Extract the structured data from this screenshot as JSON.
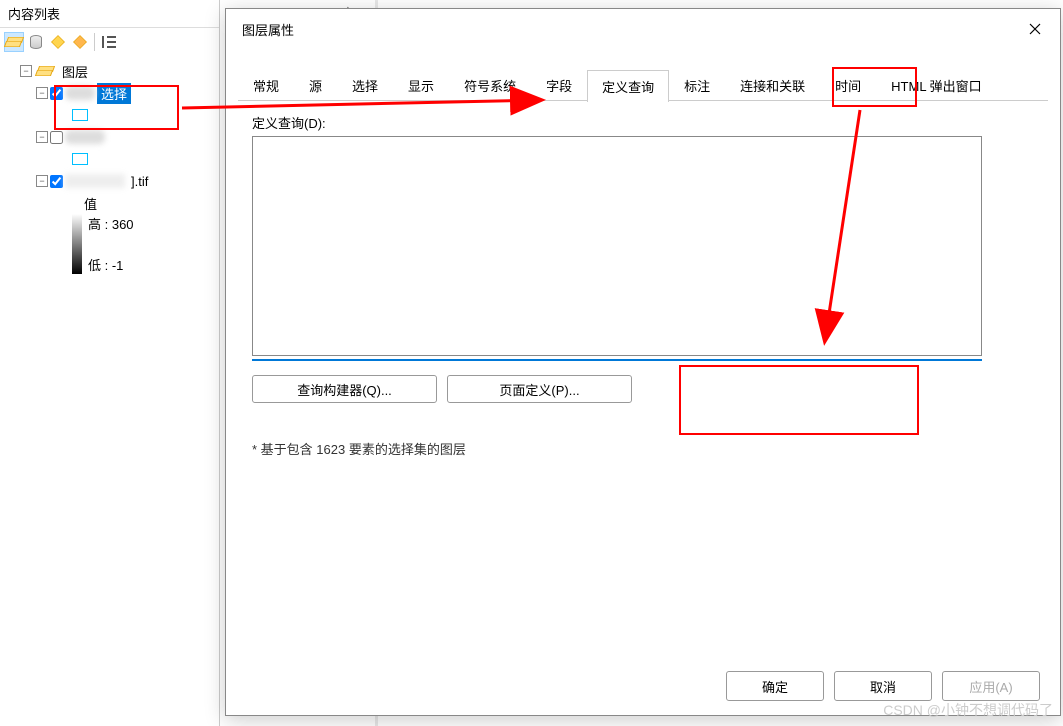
{
  "toc": {
    "title": "内容列表",
    "root_label": "图层",
    "layers": [
      {
        "label": "选择",
        "checked": true,
        "selected": true
      },
      {
        "label": "",
        "checked": false,
        "selected": false
      },
      {
        "label": "].tif",
        "checked": true,
        "selected": false
      }
    ],
    "raster": {
      "value_label": "值",
      "high_label": "高 : 360",
      "low_label": "低 : -1"
    }
  },
  "right_hint": "×",
  "dialog": {
    "title": "图层属性",
    "tabs": [
      "常规",
      "源",
      "选择",
      "显示",
      "符号系统",
      "字段",
      "定义查询",
      "标注",
      "连接和关联",
      "时间",
      "HTML 弹出窗口"
    ],
    "active_tab_index": 6,
    "query_label": "定义查询(D):",
    "query_value": "",
    "query_builder_btn": "查询构建器(Q)...",
    "page_def_btn": "页面定义(P)...",
    "note": "* 基于包含 1623 要素的选择集的图层",
    "ok_btn": "确定",
    "cancel_btn": "取消",
    "apply_btn": "应用(A)"
  },
  "watermark": "CSDN @小钟不想调代码了"
}
